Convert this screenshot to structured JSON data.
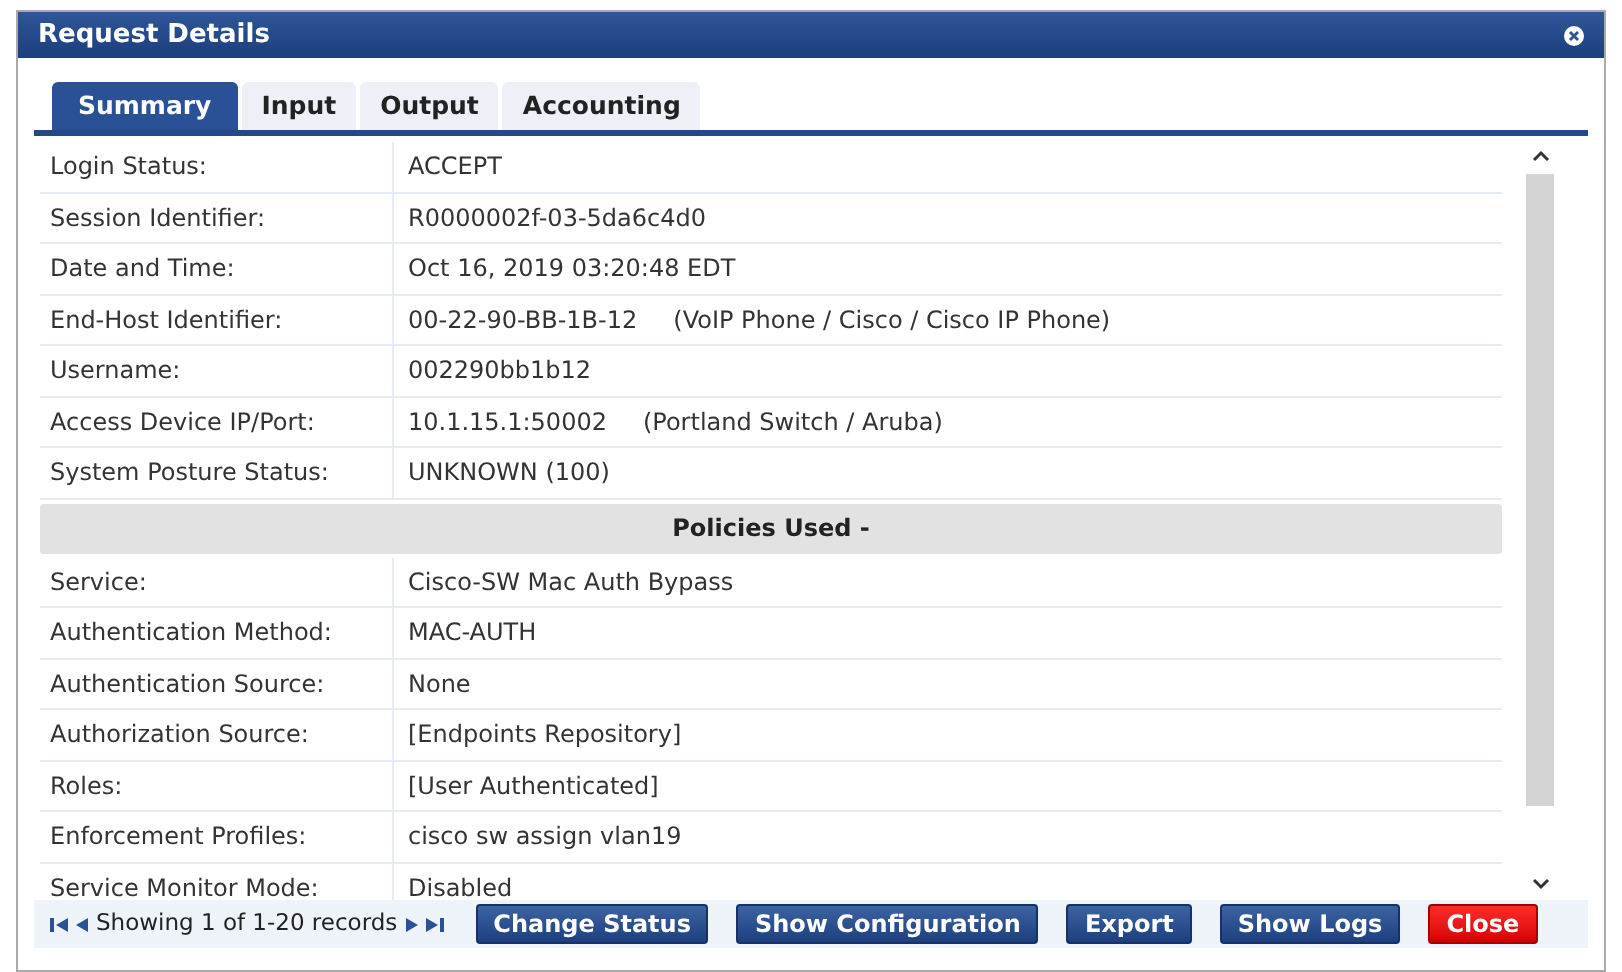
{
  "dialog": {
    "title": "Request Details"
  },
  "tabs": [
    {
      "label": "Summary",
      "selected": true
    },
    {
      "label": "Input",
      "selected": false
    },
    {
      "label": "Output",
      "selected": false
    },
    {
      "label": "Accounting",
      "selected": false
    }
  ],
  "rows": [
    {
      "kind": "field",
      "label": "Login Status:",
      "value": "ACCEPT"
    },
    {
      "kind": "field",
      "label": "Session Identifier:",
      "value": "R0000002f-03-5da6c4d0"
    },
    {
      "kind": "field",
      "label": "Date and Time:",
      "value": "Oct 16, 2019 03:20:48 EDT"
    },
    {
      "kind": "field",
      "label": "End-Host Identifier:",
      "value": "00-22-90-BB-1B-12",
      "note": "(VoIP Phone / Cisco / Cisco IP Phone)"
    },
    {
      "kind": "field",
      "label": "Username:",
      "value": "002290bb1b12"
    },
    {
      "kind": "field",
      "label": "Access Device IP/Port:",
      "value": "10.1.15.1:50002",
      "note": "(Portland Switch / Aruba)"
    },
    {
      "kind": "field",
      "label": "System Posture Status:",
      "value": "UNKNOWN (100)"
    },
    {
      "kind": "section",
      "label": "Policies Used -"
    },
    {
      "kind": "field",
      "label": "Service:",
      "value": "Cisco-SW Mac Auth Bypass"
    },
    {
      "kind": "field",
      "label": "Authentication Method:",
      "value": "MAC-AUTH"
    },
    {
      "kind": "field",
      "label": "Authentication Source:",
      "value": "None"
    },
    {
      "kind": "field",
      "label": "Authorization Source:",
      "value": "[Endpoints Repository]"
    },
    {
      "kind": "field",
      "label": "Roles:",
      "value": "[User Authenticated]"
    },
    {
      "kind": "field",
      "label": "Enforcement Profiles:",
      "value": "cisco sw assign vlan19"
    },
    {
      "kind": "field",
      "label": "Service Monitor Mode:",
      "value": "Disabled"
    }
  ],
  "pager": {
    "text": "Showing 1 of 1-20 records"
  },
  "buttons": [
    {
      "label": "Change Status",
      "kind": "primary"
    },
    {
      "label": "Show Configuration",
      "kind": "primary"
    },
    {
      "label": "Export",
      "kind": "primary"
    },
    {
      "label": "Show Logs",
      "kind": "primary"
    },
    {
      "label": "Close",
      "kind": "danger"
    }
  ]
}
